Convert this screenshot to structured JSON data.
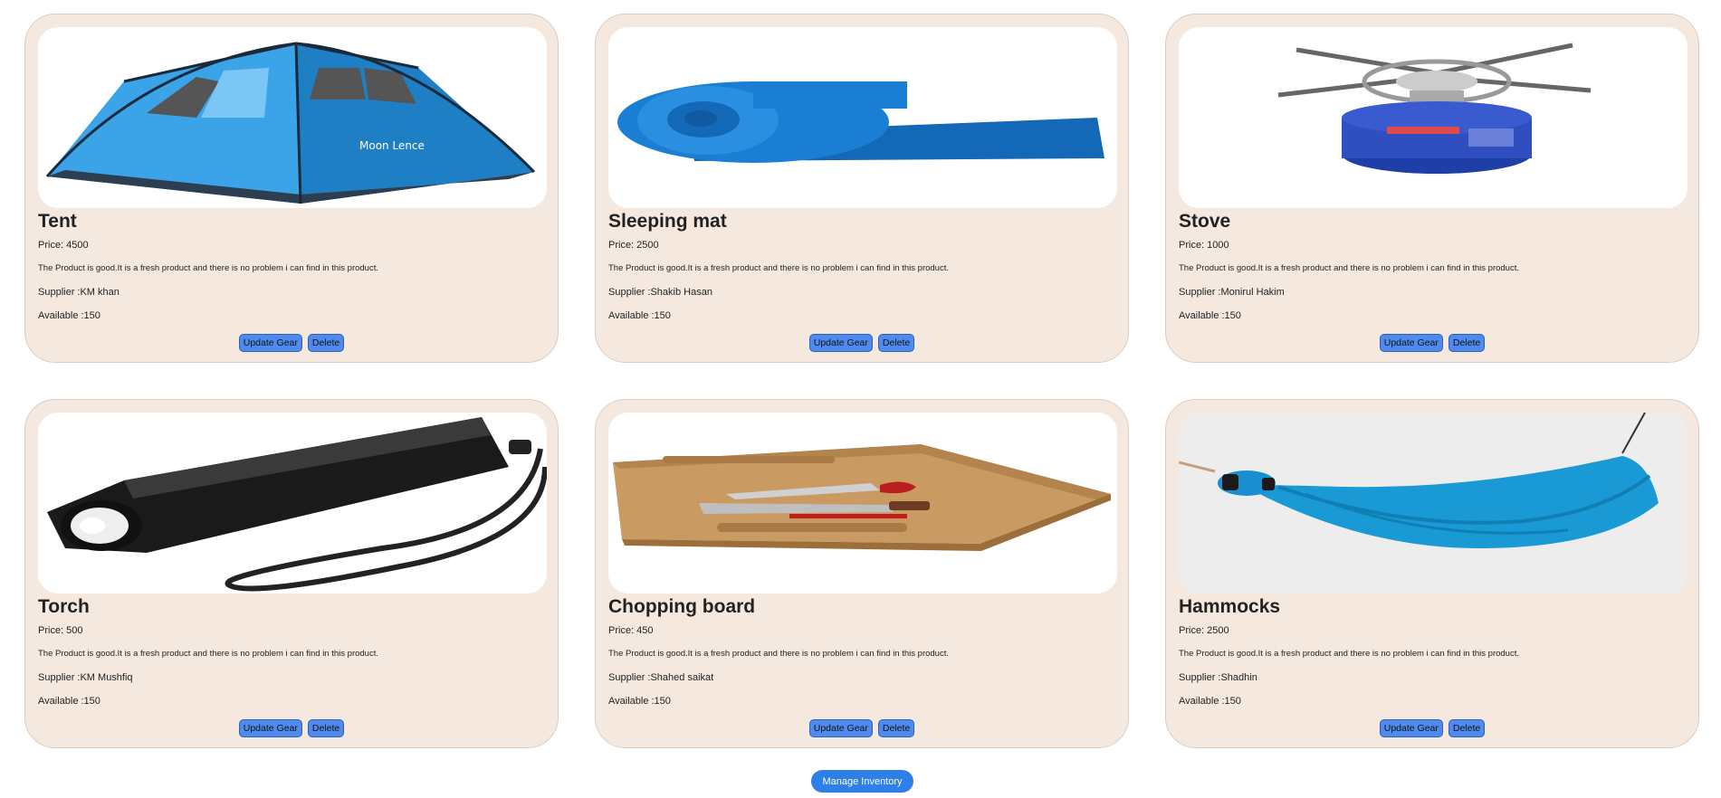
{
  "products": [
    {
      "title": "Tent",
      "price": "Price: 4500",
      "description": "The Product is good.It is a fresh product and there is no problem i can find in this product.",
      "supplier": "Supplier :KM khan",
      "available": "Available :150",
      "image_icon": "tent-image",
      "image_text": "Moon Lence"
    },
    {
      "title": "Sleeping mat",
      "price": "Price: 2500",
      "description": "The Product is good.It is a fresh product and there is no problem i can find in this product.",
      "supplier": "Supplier :Shakib Hasan",
      "available": "Available :150",
      "image_icon": "sleeping-mat-image"
    },
    {
      "title": "Stove",
      "price": "Price: 1000",
      "description": "The Product is good.It is a fresh product and there is no problem i can find in this product.",
      "supplier": "Supplier :Monirul Hakim",
      "available": "Available :150",
      "image_icon": "stove-image"
    },
    {
      "title": "Torch",
      "price": "Price: 500",
      "description": "The Product is good.It is a fresh product and there is no problem i can find in this product.",
      "supplier": "Supplier :KM Mushfiq",
      "available": "Available :150",
      "image_icon": "torch-image"
    },
    {
      "title": "Chopping board",
      "price": "Price: 450",
      "description": "The Product is good.It is a fresh product and there is no problem i can find in this product.",
      "supplier": "Supplier :Shahed saikat",
      "available": "Available :150",
      "image_icon": "chopping-board-image"
    },
    {
      "title": "Hammocks",
      "price": "Price: 2500",
      "description": "The Product is good.It is a fresh product and there is no problem i can find in this product.",
      "supplier": "Supplier :Shadhin",
      "available": "Available :150",
      "image_icon": "hammock-image"
    }
  ],
  "buttons": {
    "update_label": "Update Gear",
    "delete_label": "Delete",
    "manage_label": "Manage Inventory"
  },
  "colors": {
    "card_background": "#f5e9df",
    "button_blue": "#4f8bef",
    "manage_button": "#2f7fe8"
  }
}
